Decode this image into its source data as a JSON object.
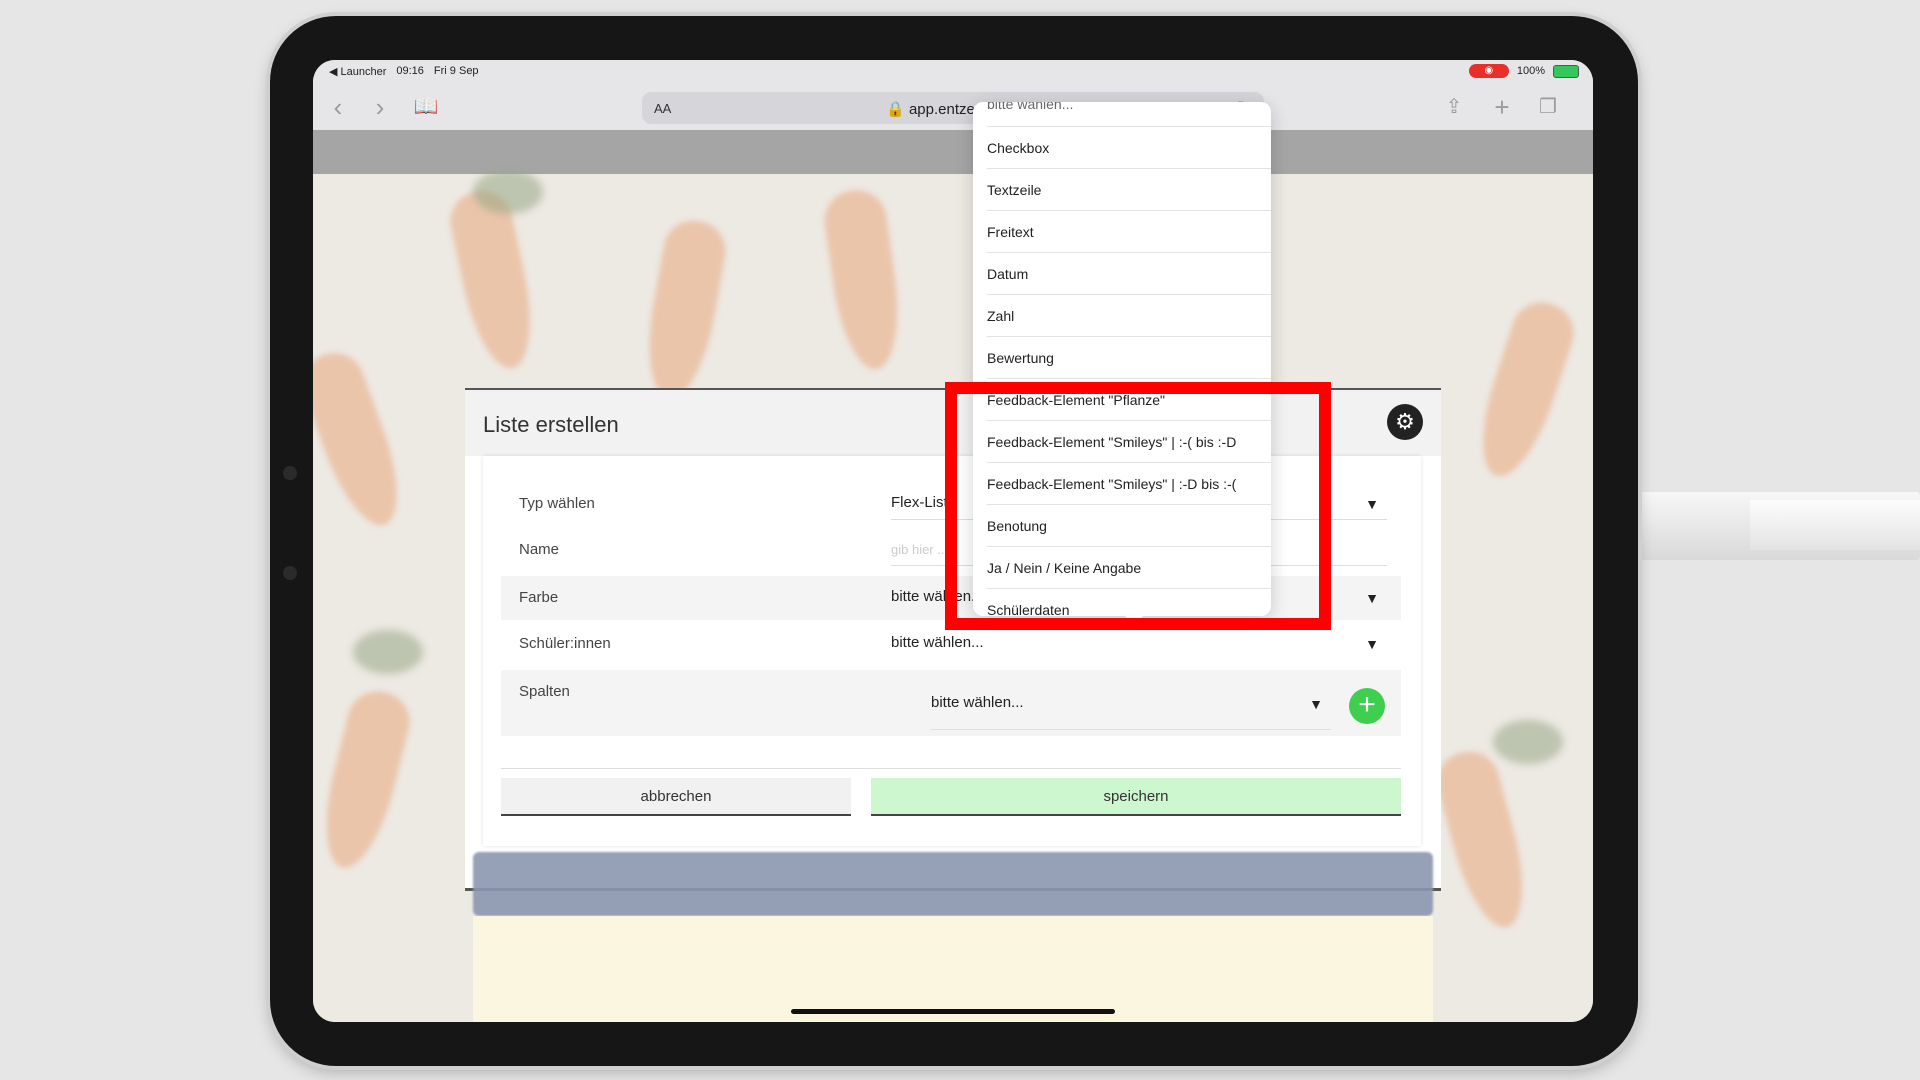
{
  "status_bar": {
    "back_app": "◀ Launcher",
    "time": "09:16",
    "date": "Fri 9 Sep",
    "battery": "100%"
  },
  "browser": {
    "text_size_label": "AA",
    "url": "🔒 app.entzettelt.de"
  },
  "modal": {
    "title": "Liste erstellen",
    "rows": {
      "typ": {
        "label": "Typ wählen",
        "value": "Flex-Liste"
      },
      "name": {
        "label": "Name",
        "placeholder": "gib hier ..."
      },
      "farbe": {
        "label": "Farbe",
        "value": "bitte wählen..."
      },
      "schueler": {
        "label": "Schüler:innen",
        "value": "bitte wählen..."
      },
      "spalten": {
        "label": "Spalten",
        "value": "bitte wählen..."
      }
    },
    "cancel_label": "abbrechen",
    "save_label": "speichern"
  },
  "dropdown": {
    "items": [
      "bitte wählen...",
      "Checkbox",
      "Textzeile",
      "Freitext",
      "Datum",
      "Zahl",
      "Bewertung",
      "Feedback-Element \"Pflanze\"",
      "Feedback-Element \"Smileys\" | :-( bis :-D",
      "Feedback-Element \"Smileys\" | :-D bis :-(",
      "Benotung",
      "Ja / Nein / Keine Angabe",
      "Schülerdaten"
    ]
  },
  "icons": {
    "back": "chevron-left-icon",
    "forward": "chevron-right-icon",
    "bookmarks": "book-icon",
    "reload": "reload-icon",
    "share": "share-icon",
    "new_tab": "plus-icon",
    "tabs": "tabs-icon",
    "settings": "gear-icon",
    "add": "plus-circle-icon"
  },
  "colors": {
    "highlight": "#ff0000",
    "save_button": "#cdf7cf",
    "add_button": "#3ecf4f",
    "recording": "#e8302a"
  }
}
